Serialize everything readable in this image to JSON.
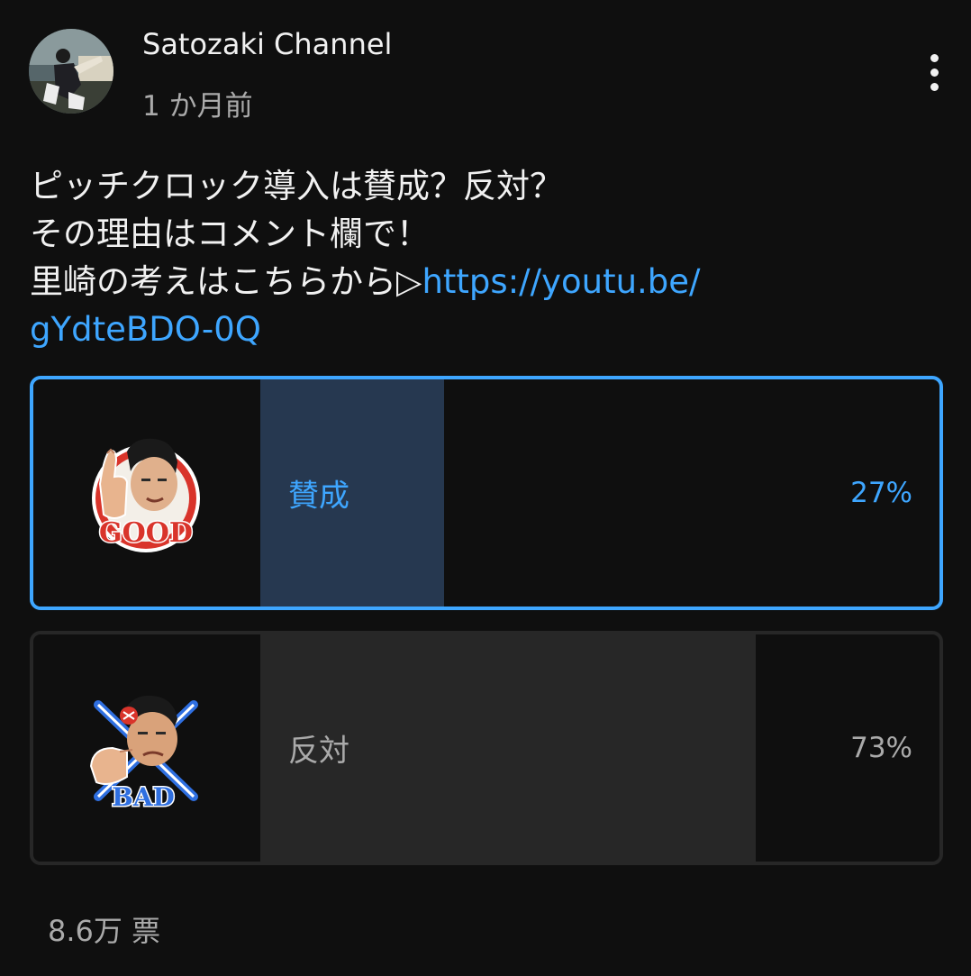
{
  "post": {
    "channel_name": "Satozaki Channel",
    "time": "1 か月前",
    "menu_icon": "more-vert-icon",
    "body_lines": [
      "ピッチクロック導入は賛成？反対？",
      "その理由はコメント欄で！",
      "里崎の考えはこちらから▷"
    ],
    "link_line1": "https://youtu.be/",
    "link_line2": "gYdteBDO-0Q"
  },
  "poll": {
    "options": [
      {
        "label": "賛成",
        "percent_text": "27%",
        "percent": 27,
        "selected": true,
        "sticker_text": "GOOD",
        "image_icon": "good-thumbs-up-sticker"
      },
      {
        "label": "反対",
        "percent_text": "73%",
        "percent": 73,
        "selected": false,
        "sticker_text": "BAD",
        "image_icon": "bad-pointing-sticker"
      }
    ],
    "vote_count": "8.6万 票"
  },
  "colors": {
    "background": "#0f0f0f",
    "accent": "#3ea6ff",
    "secondary_text": "#aaaaaa",
    "selected_fill": "#263850",
    "unselected_fill": "#272727"
  }
}
